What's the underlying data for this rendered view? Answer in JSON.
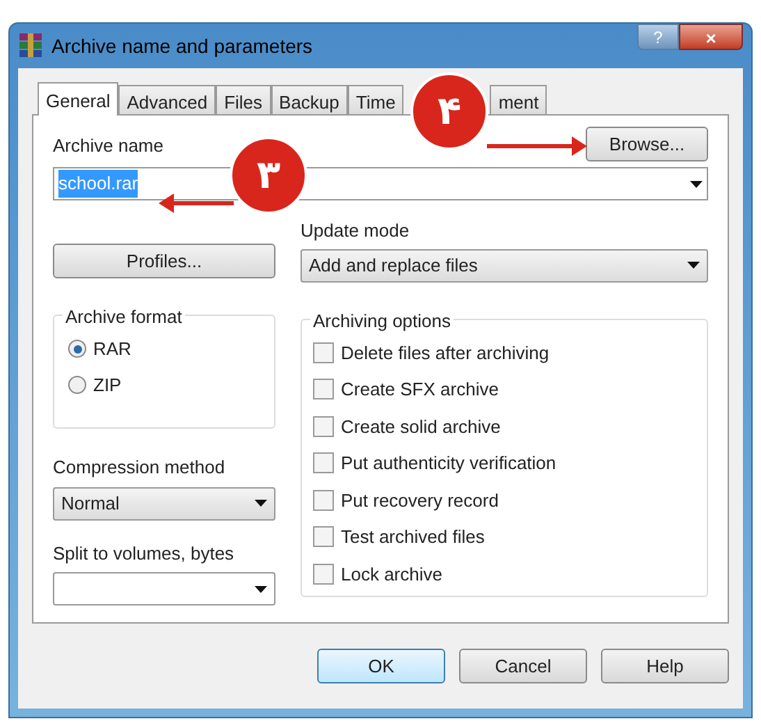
{
  "window": {
    "title": "Archive name and parameters",
    "help_button": "?",
    "close_button": "×"
  },
  "tabs": [
    {
      "label": "General",
      "selected": true
    },
    {
      "label": "Advanced",
      "selected": false
    },
    {
      "label": "Files",
      "selected": false
    },
    {
      "label": "Backup",
      "selected": false
    },
    {
      "label": "Time",
      "selected": false
    },
    {
      "label": "ment",
      "selected": false
    }
  ],
  "archive_name": {
    "label": "Archive name",
    "value": "school.rar",
    "browse_button": "Browse..."
  },
  "profiles_button": "Profiles...",
  "update_mode": {
    "label": "Update mode",
    "value": "Add and replace files"
  },
  "archive_format": {
    "label": "Archive format",
    "options": [
      {
        "label": "RAR",
        "selected": true
      },
      {
        "label": "ZIP",
        "selected": false
      }
    ]
  },
  "compression_method": {
    "label": "Compression method",
    "value": "Normal"
  },
  "split_volumes": {
    "label": "Split to volumes, bytes"
  },
  "archiving_options": {
    "label": "Archiving options",
    "items": [
      {
        "label": "Delete files after archiving",
        "checked": false
      },
      {
        "label": "Create SFX archive",
        "checked": false
      },
      {
        "label": "Create solid archive",
        "checked": false
      },
      {
        "label": "Put authenticity verification",
        "checked": false
      },
      {
        "label": "Put recovery record",
        "checked": false
      },
      {
        "label": "Test archived files",
        "checked": false
      },
      {
        "label": "Lock archive",
        "checked": false
      }
    ]
  },
  "buttons": [
    {
      "label": "OK",
      "default": true
    },
    {
      "label": "Cancel",
      "default": false
    },
    {
      "label": "Help",
      "default": false
    }
  ],
  "annotations": [
    {
      "label": "۳"
    },
    {
      "label": "۴"
    }
  ]
}
